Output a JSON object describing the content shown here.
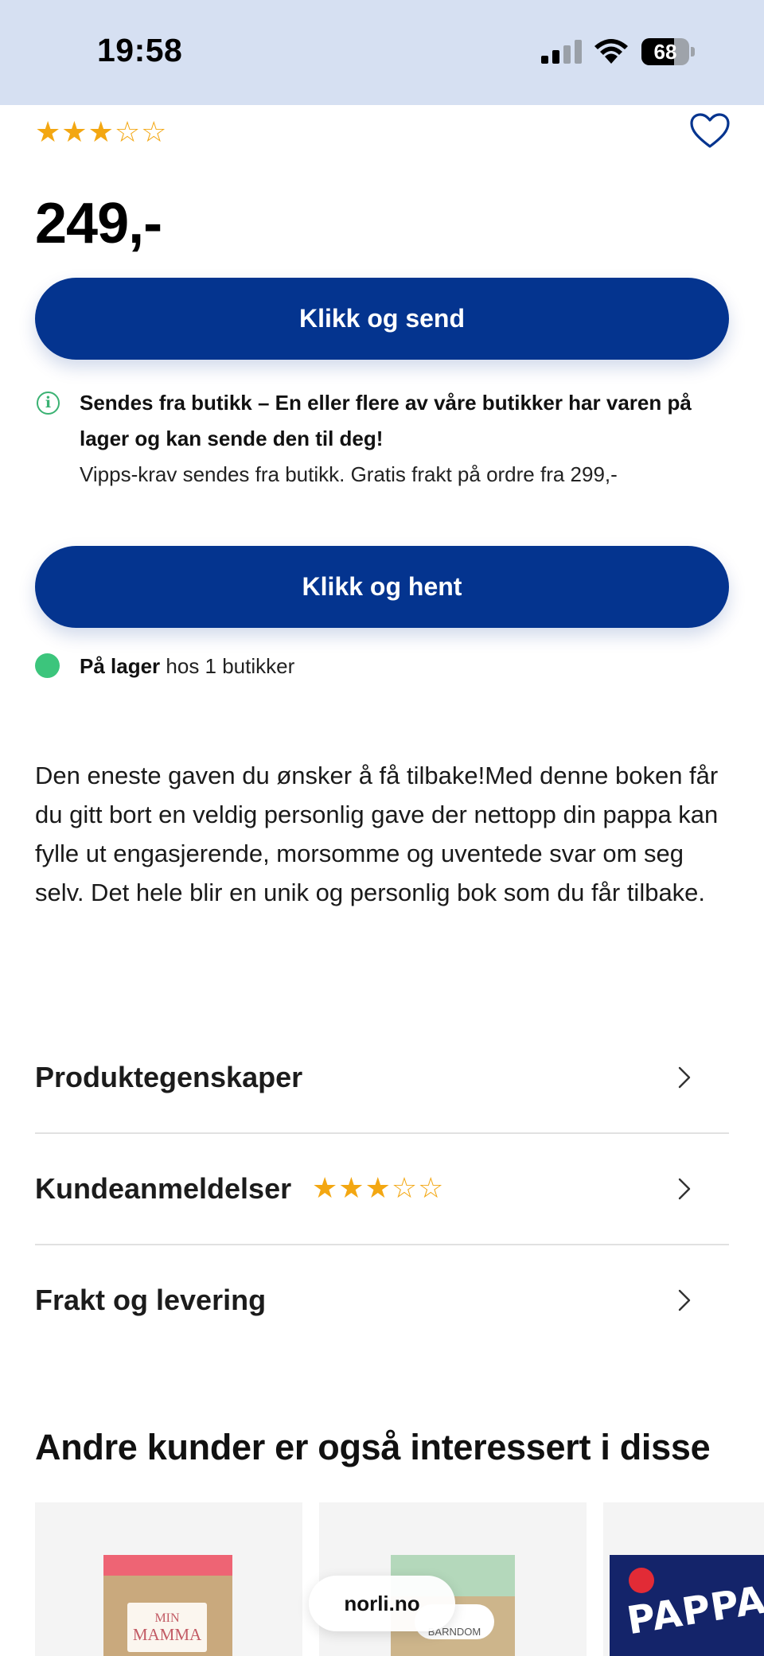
{
  "status_bar": {
    "time": "19:58",
    "battery": "68",
    "battery_level_percent": 68,
    "signal_bars_active": 2,
    "signal_bars_total": 4
  },
  "product": {
    "rating": 3,
    "rating_max": 5,
    "favorite_icon": "heart-outline-icon",
    "price": "249,-"
  },
  "buttons": {
    "click_and_send": "Klikk og send",
    "click_and_collect": "Klikk og hent"
  },
  "shipping_info": {
    "icon": "info-icon",
    "title": "Sendes fra butikk – En eller flere av våre butikker har varen på lager og kan sende den til deg!",
    "subtitle": "Vipps-krav sendes fra butikk. Gratis frakt på ordre fra 299,-"
  },
  "stock": {
    "status_bold": "På lager",
    "status_rest": " hos 1 butikker",
    "color": "#3cc57c"
  },
  "description": "Den eneste gaven du ønsker å få tilbake!Med denne boken får du gitt bort en veldig personlig gave der nettopp din pappa kan fylle ut engasjerende, morsomme og uventede svar om seg selv. Det hele blir en unik og personlig bok som du får tilbake.",
  "accordion": [
    {
      "label": "Produktegenskaper"
    },
    {
      "label": "Kundeanmeldelser",
      "rating": 3
    },
    {
      "label": "Frakt og levering"
    }
  ],
  "related": {
    "title": "Andre kunder er også interessert i disse",
    "items": [
      {
        "cover_line1": "MIN",
        "cover_line2": "MAMMA"
      },
      {
        "cover_text": "BARNDOM"
      },
      {
        "cover_text": "PAPPAS"
      }
    ]
  },
  "browser": {
    "url": "norli.no"
  },
  "colors": {
    "primary": "#04348f",
    "star": "#f3a712",
    "status_bar_bg": "#d6e0f2",
    "info_green": "#3bb273"
  }
}
